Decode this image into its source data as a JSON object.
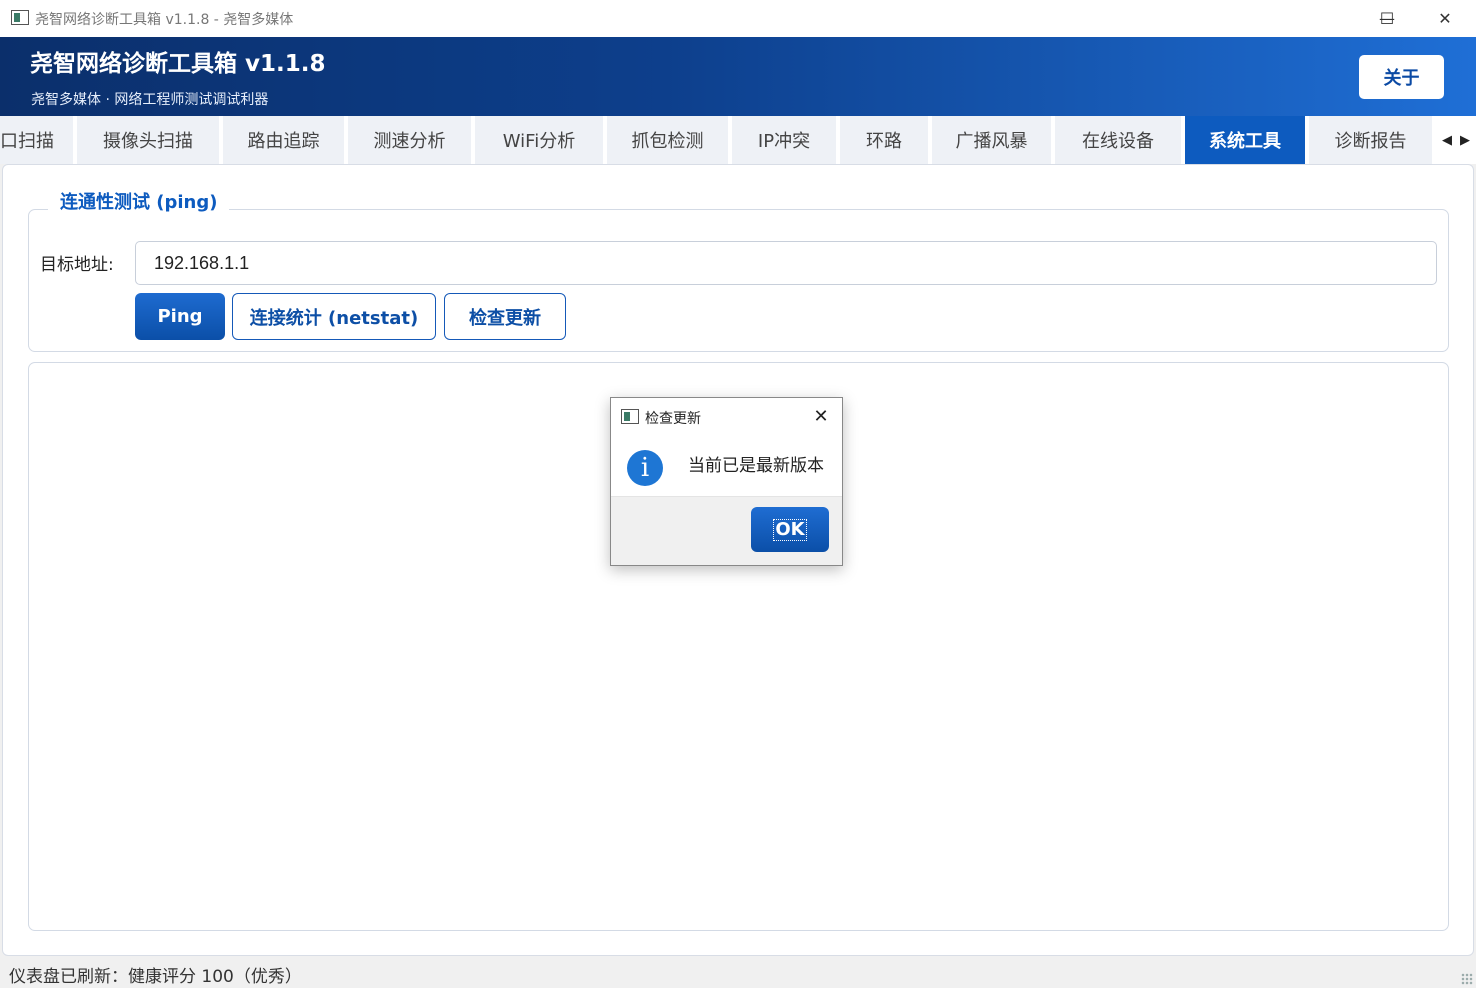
{
  "window": {
    "title": "尧智网络诊断工具箱 v1.1.8 - 尧智多媒体",
    "minimize_glyph": "—",
    "maximize_glyph": "☐",
    "close_glyph": "✕"
  },
  "header": {
    "title": "尧智网络诊断工具箱  v1.1.8",
    "subtitle": "尧智多媒体 · 网络工程师测试调试利器",
    "about_button": "关于"
  },
  "tabs": [
    {
      "label": "口扫描",
      "active": false
    },
    {
      "label": "摄像头扫描",
      "active": false
    },
    {
      "label": "路由追踪",
      "active": false
    },
    {
      "label": "测速分析",
      "active": false
    },
    {
      "label": "WiFi分析",
      "active": false
    },
    {
      "label": "抓包检测",
      "active": false
    },
    {
      "label": "IP冲突",
      "active": false
    },
    {
      "label": "环路",
      "active": false
    },
    {
      "label": "广播风暴",
      "active": false
    },
    {
      "label": "在线设备",
      "active": false
    },
    {
      "label": "系统工具",
      "active": true
    },
    {
      "label": "诊断报告",
      "active": false
    }
  ],
  "tab_scroll": {
    "left": "◀",
    "right": "▶"
  },
  "ping_group": {
    "title": "连通性测试 (ping)",
    "target_label": "目标地址:",
    "target_value": "192.168.1.1",
    "buttons": {
      "ping": "Ping",
      "netstat": "连接统计 (netstat)",
      "check_update": "检查更新"
    }
  },
  "output_text": "",
  "status_bar": {
    "text": "仪表盘已刷新：健康评分 100（优秀）"
  },
  "dialog": {
    "title": "检查更新",
    "message": "当前已是最新版本",
    "close_glyph": "✕",
    "info_glyph": "i",
    "ok_button": "OK"
  },
  "colors": {
    "brand_dark": "#0b2f6b",
    "brand_light": "#1f6fd6",
    "accent": "#0d5bbf",
    "info": "#1e76d4"
  }
}
